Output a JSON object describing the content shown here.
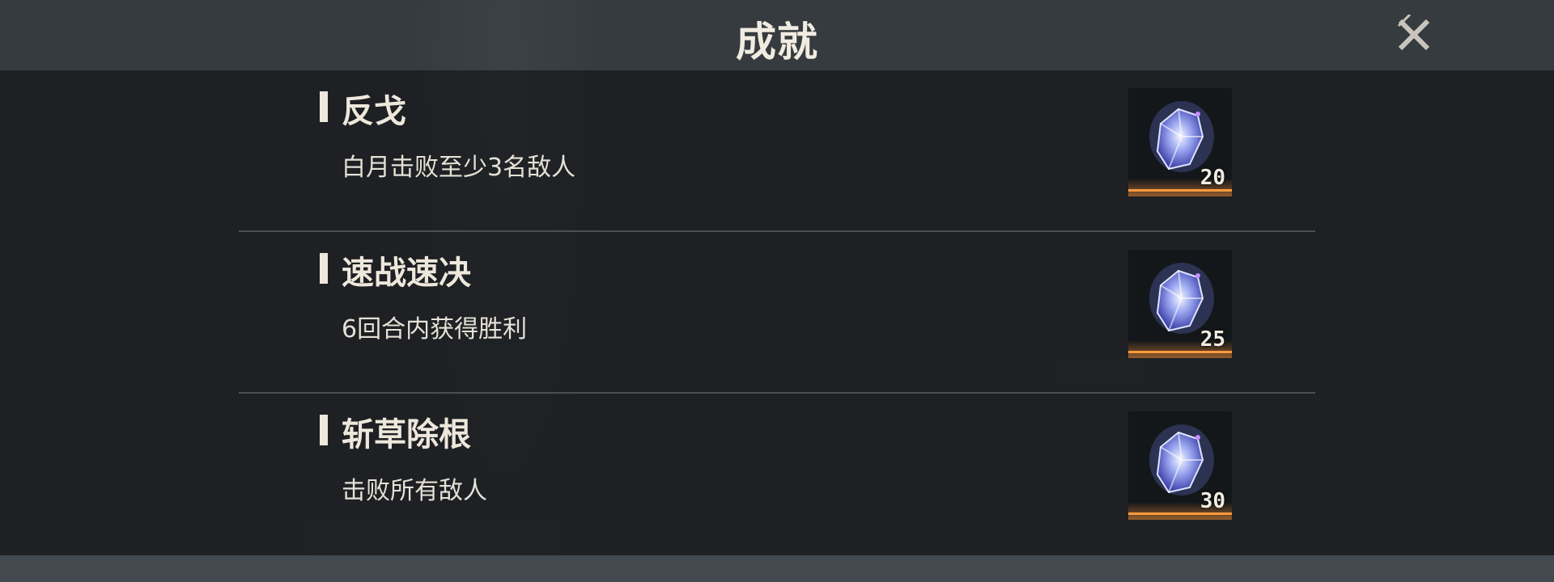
{
  "header": {
    "title": "成就",
    "close_icon": "close-x-icon"
  },
  "achievements": [
    {
      "title": "反戈",
      "description": "白月击败至少3名敌人",
      "reward_count": "20",
      "reward_icon": "crystal-gem-icon"
    },
    {
      "title": "速战速决",
      "description": "6回合内获得胜利",
      "reward_count": "25",
      "reward_icon": "crystal-gem-icon"
    },
    {
      "title": "斩草除根",
      "description": "击败所有敌人",
      "reward_count": "30",
      "reward_icon": "crystal-gem-icon"
    }
  ],
  "colors": {
    "accent_orange": "#ff9a3c",
    "text_light": "#eee8dc",
    "panel_dark": "#1c1f22"
  }
}
